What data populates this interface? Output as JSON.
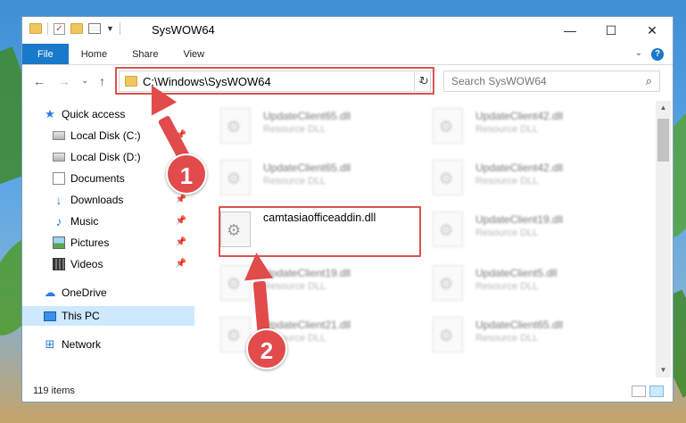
{
  "window": {
    "title": "SysWOW64",
    "controls": {
      "minimize": "—",
      "maximize": "☐",
      "close": "✕"
    }
  },
  "ribbon": {
    "tabs": [
      "File",
      "Home",
      "Share",
      "View"
    ],
    "expand_icon": "⌄",
    "help_icon": "?"
  },
  "navigation": {
    "back": "←",
    "forward": "→",
    "recent": "⌄",
    "up": "↑",
    "address": "C:\\Windows\\SysWOW64",
    "address_dropdown": "⌄",
    "refresh": "↻",
    "search_placeholder": "Search SysWOW64",
    "search_icon": "⌕"
  },
  "sidebar": {
    "items": [
      {
        "label": "Quick access",
        "icon": "star-icon",
        "pinned": false
      },
      {
        "label": "Local Disk (C:)",
        "icon": "disk-icon",
        "pinned": true
      },
      {
        "label": "Local Disk (D:)",
        "icon": "disk-icon",
        "pinned": true
      },
      {
        "label": "Documents",
        "icon": "documents-icon",
        "pinned": true
      },
      {
        "label": "Downloads",
        "icon": "downloads-icon",
        "pinned": true
      },
      {
        "label": "Music",
        "icon": "music-icon",
        "pinned": true
      },
      {
        "label": "Pictures",
        "icon": "pictures-icon",
        "pinned": true
      },
      {
        "label": "Videos",
        "icon": "videos-icon",
        "pinned": true
      },
      {
        "label": "OneDrive",
        "icon": "cloud-icon",
        "pinned": false
      },
      {
        "label": "This PC",
        "icon": "pc-icon",
        "pinned": false,
        "selected": true
      },
      {
        "label": "Network",
        "icon": "network-icon",
        "pinned": false
      }
    ],
    "pin_glyph": "📌"
  },
  "files": {
    "items": [
      {
        "name": "UpdateClient65.dll",
        "desc": "Resource DLL"
      },
      {
        "name": "UpdateClient42.dll",
        "desc": "Resource DLL"
      },
      {
        "name": "UpdateClient65.dll",
        "desc": "Resource DLL"
      },
      {
        "name": "UpdateClient42.dll",
        "desc": "Resource DLL"
      },
      {
        "name": "camtasiaofficeaddin.dll",
        "desc": ""
      },
      {
        "name": "UpdateClient19.dll",
        "desc": "Resource DLL"
      },
      {
        "name": "UpdateClient19.dll",
        "desc": "Resource DLL"
      },
      {
        "name": "UpdateClient5.dll",
        "desc": "Resource DLL"
      },
      {
        "name": "UpdateClient21.dll",
        "desc": "Resource DLL"
      },
      {
        "name": "UpdateClient65.dll",
        "desc": "Resource DLL"
      }
    ]
  },
  "status": {
    "item_count": "119 items"
  },
  "annotations": {
    "badge_1": "1",
    "badge_2": "2",
    "highlight_color": "#d9534f"
  },
  "colors": {
    "accent": "#1979ca",
    "selection": "#cde8ff",
    "annotation": "#e14b4b"
  }
}
